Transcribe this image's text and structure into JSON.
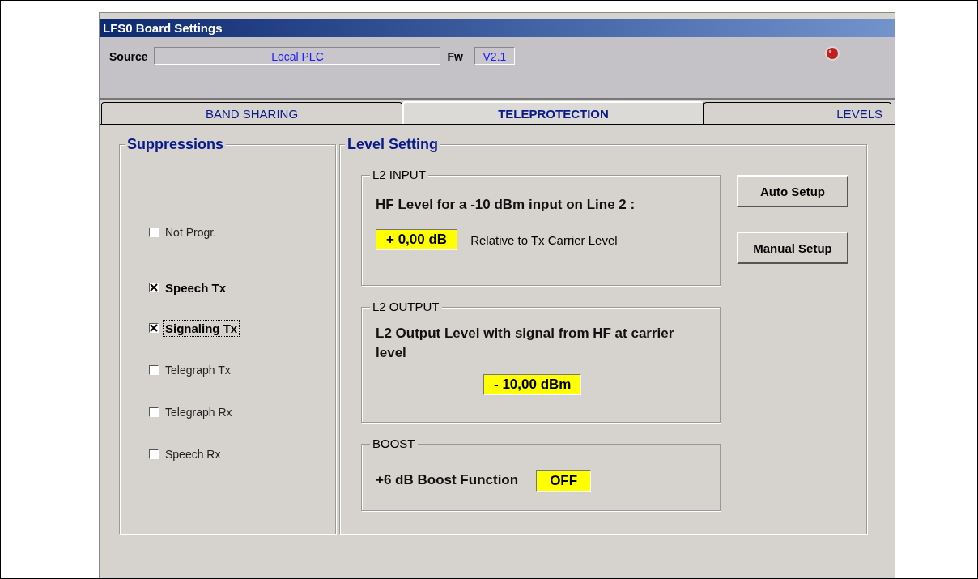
{
  "window": {
    "title": "LFS0 Board Settings"
  },
  "header": {
    "source_label": "Source",
    "source_value": "Local PLC",
    "fw_label": "Fw",
    "fw_value": "V2.1",
    "led_on": true
  },
  "tabs": [
    {
      "label": "BAND SHARING",
      "selected": false
    },
    {
      "label": "TELEPROTECTION",
      "selected": true
    },
    {
      "label": "LEVELS",
      "selected": false
    }
  ],
  "suppressions": {
    "title": "Suppressions",
    "items": [
      {
        "label": "Not Progr.",
        "checked": false,
        "focused": false
      },
      {
        "label": "Speech Tx",
        "checked": true,
        "focused": false
      },
      {
        "label": "Signaling Tx",
        "checked": true,
        "focused": true
      },
      {
        "label": "Telegraph Tx",
        "checked": false,
        "focused": false
      },
      {
        "label": "Telegraph Rx",
        "checked": false,
        "focused": false
      },
      {
        "label": "Speech Rx",
        "checked": false,
        "focused": false
      }
    ]
  },
  "level_setting": {
    "title": "Level Setting",
    "l2_input": {
      "title": "L2 INPUT",
      "heading": "HF Level for a -10 dBm input on Line 2 :",
      "value": "+ 0,00 dB",
      "note": "Relative to Tx Carrier Level"
    },
    "l2_output": {
      "title": "L2 OUTPUT",
      "heading": "L2 Output Level with signal from HF at carrier level",
      "value": "- 10,00 dBm"
    },
    "boost": {
      "title": "BOOST",
      "label": "+6 dB Boost Function",
      "value": "OFF"
    },
    "buttons": [
      "Auto Setup",
      "Manual Setup"
    ]
  }
}
